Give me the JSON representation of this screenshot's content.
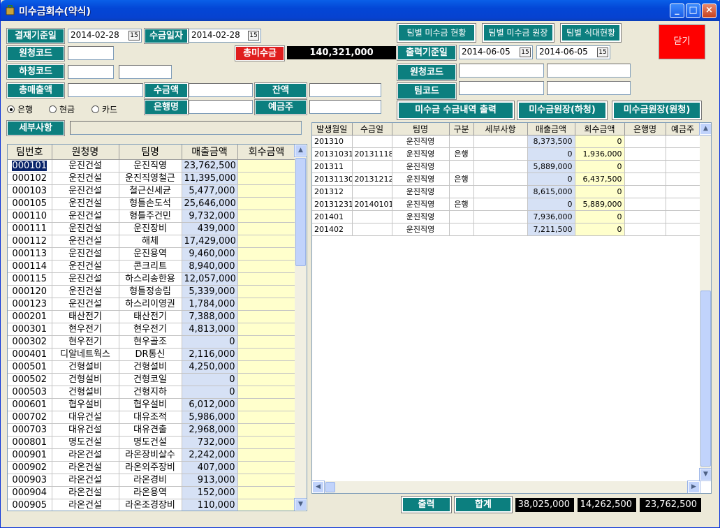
{
  "window": {
    "title": "미수금회수(약식)"
  },
  "titlebar_buttons": {
    "minimize": "_",
    "maximize": "□",
    "close": "×"
  },
  "filters": {
    "settle_base_label": "결재기준일",
    "settle_base_date": "2014-02-28",
    "collect_date_label": "수금일자",
    "collect_date": "2014-02-28",
    "contractor_code_label": "원청코드",
    "contractor_code": "",
    "sub_code_label": "하청코드",
    "sub_code_1": "",
    "sub_code_2": "",
    "total_sales_label": "총매출액",
    "total_sales": "",
    "collect_amount_label": "수금액",
    "collect_amount": "",
    "balance_label": "잔액",
    "balance": "",
    "bank_name_label": "은행명",
    "bank_name": "",
    "depositor_label": "예금주",
    "depositor": "",
    "detail_label": "세부사항",
    "detail": "",
    "payment_methods": [
      "은행",
      "현금",
      "카드"
    ],
    "payment_selected": "은행",
    "cal_glyph": "15"
  },
  "total_unpaid": {
    "label": "총미수금",
    "value": "140,321,000"
  },
  "output_panel": {
    "team_unpaid_status": "팀별 미수금 현황",
    "team_unpaid_ledger": "팀별 미수금 원장",
    "team_meal_status": "팀별 식대현황",
    "close": "닫기",
    "output_base_label": "출력기준일",
    "output_date_from": "2014-06-05",
    "output_date_to": "2014-06-05",
    "contractor_code_label": "원청코드",
    "team_code_label": "팀코드",
    "unpaid_collect_print": "미수금 수금내역 출력",
    "unpaid_ledger_sub": "미수금원장(하청)",
    "unpaid_ledger_main": "미수금원장(원청)"
  },
  "left_table": {
    "columns": [
      "팀번호",
      "원청명",
      "팀명",
      "매출금액",
      "회수금액"
    ],
    "rows": [
      [
        "000101",
        "운진건설",
        "운진직영",
        "23,762,500",
        ""
      ],
      [
        "000102",
        "운진건설",
        "운진직영철근",
        "11,395,000",
        ""
      ],
      [
        "000103",
        "운진건설",
        "철근신세균",
        "5,477,000",
        ""
      ],
      [
        "000105",
        "운진건설",
        "형틀손도석",
        "25,646,000",
        ""
      ],
      [
        "000110",
        "운진건설",
        "형틀주건민",
        "9,732,000",
        ""
      ],
      [
        "000111",
        "운진건설",
        "운진장비",
        "439,000",
        ""
      ],
      [
        "000112",
        "운진건설",
        "해체",
        "17,429,000",
        ""
      ],
      [
        "000113",
        "운진건설",
        "운진용역",
        "9,460,000",
        ""
      ],
      [
        "000114",
        "운진건설",
        "콘크리트",
        "8,940,000",
        ""
      ],
      [
        "000115",
        "운진건설",
        "하스리송한용",
        "12,057,000",
        ""
      ],
      [
        "000120",
        "운진건설",
        "형틀정송림",
        "5,339,000",
        ""
      ],
      [
        "000123",
        "운진건설",
        "하스리이영권",
        "1,784,000",
        ""
      ],
      [
        "000201",
        "태산전기",
        "태산전기",
        "7,388,000",
        ""
      ],
      [
        "000301",
        "현우전기",
        "현우전기",
        "4,813,000",
        ""
      ],
      [
        "000302",
        "현우전기",
        "현우골조",
        "0",
        ""
      ],
      [
        "000401",
        "디알네트웍스",
        "DR통신",
        "2,116,000",
        ""
      ],
      [
        "000501",
        "건형설비",
        "건형설비",
        "4,250,000",
        ""
      ],
      [
        "000502",
        "건형설비",
        "건형코일",
        "0",
        ""
      ],
      [
        "000503",
        "건형설비",
        "건형지하",
        "0",
        ""
      ],
      [
        "000601",
        "협우설비",
        "협우설비",
        "6,012,000",
        ""
      ],
      [
        "000702",
        "대유건설",
        "대유조적",
        "5,986,000",
        ""
      ],
      [
        "000703",
        "대유건설",
        "대유견출",
        "2,968,000",
        ""
      ],
      [
        "000801",
        "명도건설",
        "명도건설",
        "732,000",
        ""
      ],
      [
        "000901",
        "라온건설",
        "라온장비살수",
        "2,242,000",
        ""
      ],
      [
        "000902",
        "라온건설",
        "라온외주장비",
        "407,000",
        ""
      ],
      [
        "000903",
        "라온건설",
        "라온경비",
        "913,000",
        ""
      ],
      [
        "000904",
        "라온건설",
        "라온용역",
        "152,000",
        ""
      ],
      [
        "000905",
        "라온건설",
        "라온조경장비",
        "110,000",
        ""
      ]
    ]
  },
  "right_table": {
    "columns": [
      "발생월일",
      "수금일",
      "팀명",
      "구분",
      "세부사항",
      "매출금액",
      "회수금액",
      "은행명",
      "예금주"
    ],
    "rows": [
      [
        "201310",
        "",
        "운진직영",
        "",
        "",
        "8,373,500",
        "0",
        "",
        ""
      ],
      [
        "20131031",
        "20131118",
        "운진직영",
        "은행",
        "",
        "0",
        "1,936,000",
        "",
        ""
      ],
      [
        "201311",
        "",
        "운진직영",
        "",
        "",
        "5,889,000",
        "0",
        "",
        ""
      ],
      [
        "20131130",
        "20131212",
        "운진직영",
        "은행",
        "",
        "0",
        "6,437,500",
        "",
        ""
      ],
      [
        "201312",
        "",
        "운진직영",
        "",
        "",
        "8,615,000",
        "0",
        "",
        ""
      ],
      [
        "20131231",
        "20140101",
        "운진직영",
        "은행",
        "",
        "0",
        "5,889,000",
        "",
        ""
      ],
      [
        "201401",
        "",
        "운진직영",
        "",
        "",
        "7,936,000",
        "0",
        "",
        ""
      ],
      [
        "201402",
        "",
        "운진직영",
        "",
        "",
        "7,211,500",
        "0",
        "",
        ""
      ]
    ]
  },
  "footer": {
    "print_label": "출력",
    "total_label": "합계",
    "sales_total": "38,025,000",
    "collected_total": "14,262,500",
    "unpaid_total": "23,762,500"
  },
  "scroll_glyphs": {
    "up": "▲",
    "down": "▼",
    "left": "◀",
    "right": "▶"
  },
  "colors": {
    "label_teal": "#0C7F7F",
    "alert_red": "#E01E1E",
    "close_red": "#FF0000",
    "sales_blue": "#D6E1F5",
    "collect_yellow": "#FFFFCC"
  }
}
